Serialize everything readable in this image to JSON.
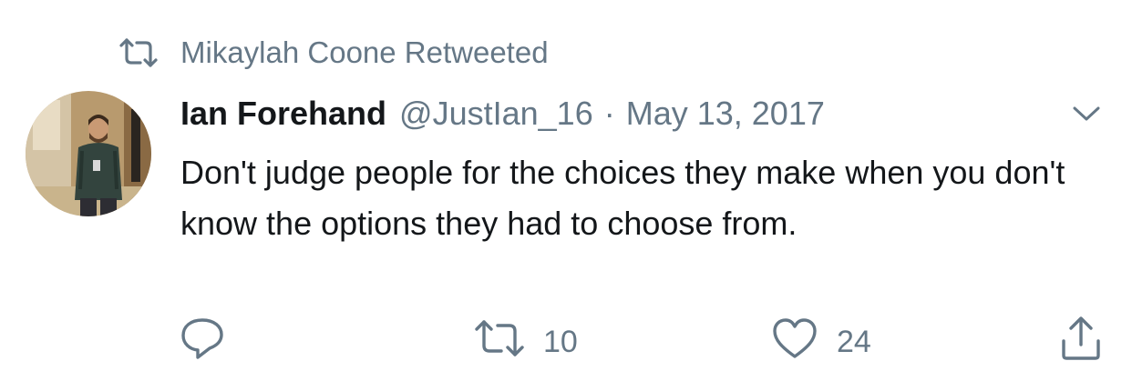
{
  "retweet_context": {
    "icon": "retweet-icon",
    "text": "Mikaylah Coone Retweeted"
  },
  "author": {
    "name": "Ian Forehand",
    "handle": "@JustIan_16",
    "avatar_icon": "profile-photo"
  },
  "meta": {
    "separator": "·",
    "date": "May 13, 2017"
  },
  "menu": {
    "icon": "chevron-down-icon"
  },
  "tweet": {
    "text": "Don't judge people for the choices they make when you don't know the options they had to choose from."
  },
  "actions": {
    "reply": {
      "icon": "reply-icon",
      "count": ""
    },
    "retweet": {
      "icon": "retweet-icon",
      "count": "10"
    },
    "like": {
      "icon": "heart-icon",
      "count": "24"
    },
    "share": {
      "icon": "share-icon"
    }
  },
  "colors": {
    "text_primary": "#14171a",
    "text_secondary": "#657786",
    "background": "#ffffff"
  }
}
